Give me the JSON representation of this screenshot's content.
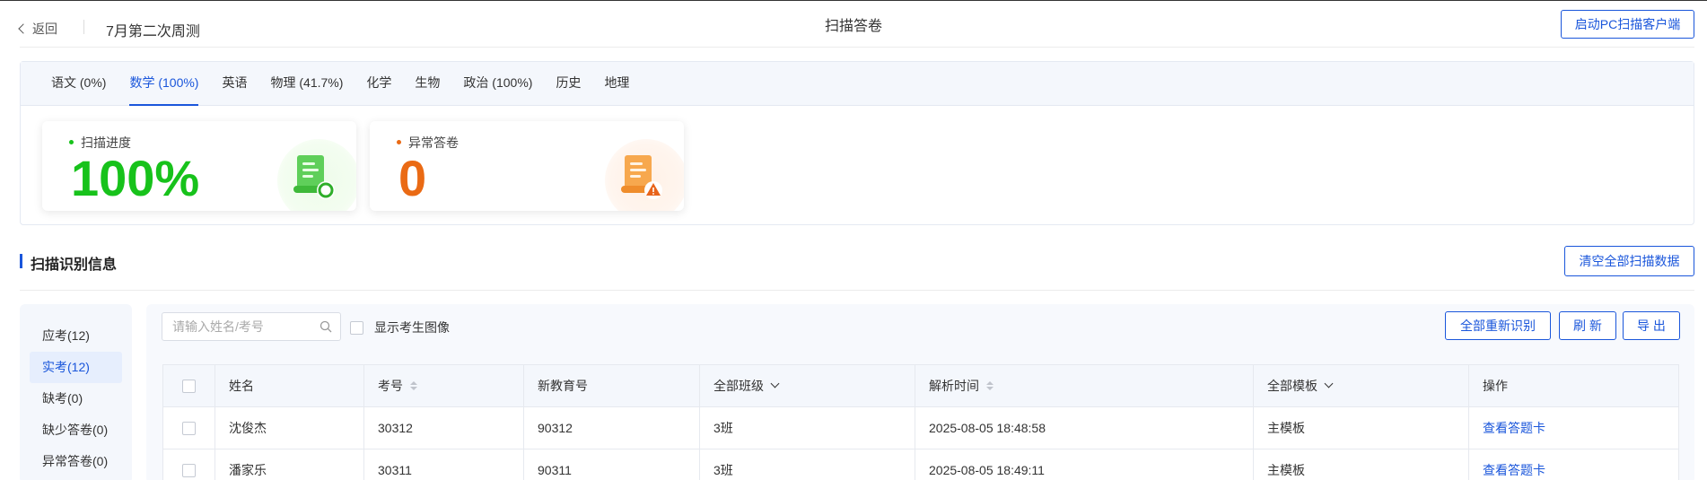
{
  "header": {
    "back_label": "返回",
    "exam_title": "7月第二次周测",
    "page_title": "扫描答卷",
    "launch_button": "启动PC扫描客户端"
  },
  "subjects": [
    {
      "label": "语文 (0%)",
      "active": false
    },
    {
      "label": "数学 (100%)",
      "active": true
    },
    {
      "label": "英语",
      "active": false
    },
    {
      "label": "物理 (41.7%)",
      "active": false
    },
    {
      "label": "化学",
      "active": false
    },
    {
      "label": "生物",
      "active": false
    },
    {
      "label": "政治 (100%)",
      "active": false
    },
    {
      "label": "历史",
      "active": false
    },
    {
      "label": "地理",
      "active": false
    }
  ],
  "stats": {
    "progress": {
      "label": "扫描进度",
      "value": "100%",
      "color": "#17c21b"
    },
    "abnormal": {
      "label": "异常答卷",
      "value": "0",
      "color": "#ea6a14"
    }
  },
  "section": {
    "title": "扫描识别信息",
    "clear_button": "清空全部扫描数据"
  },
  "filters": [
    {
      "label": "应考(12)",
      "active": false
    },
    {
      "label": "实考(12)",
      "active": true
    },
    {
      "label": "缺考(0)",
      "active": false
    },
    {
      "label": "缺少答卷(0)",
      "active": false
    },
    {
      "label": "异常答卷(0)",
      "active": false
    }
  ],
  "toolbar": {
    "search_placeholder": "请输入姓名/考号",
    "show_photo_label": "显示考生图像",
    "reidentify_button": "全部重新识别",
    "refresh_button": "刷 新",
    "export_button": "导 出"
  },
  "table": {
    "headers": {
      "name": "姓名",
      "exam_no": "考号",
      "edu_no": "新教育号",
      "class": "全部班级",
      "time": "解析时间",
      "template": "全部模板",
      "action": "操作"
    },
    "rows": [
      {
        "name": "沈俊杰",
        "exam_no": "30312",
        "edu_no": "90312",
        "class": "3班",
        "time": "2025-08-05 18:48:58",
        "template": "主模板",
        "action": "查看答题卡"
      },
      {
        "name": "潘家乐",
        "exam_no": "30311",
        "edu_no": "90311",
        "class": "3班",
        "time": "2025-08-05 18:49:11",
        "template": "主模板",
        "action": "查看答题卡"
      }
    ]
  },
  "colors": {
    "accent": "#1a56db",
    "progress": "#17c21b",
    "abnormal": "#ea6a14"
  }
}
